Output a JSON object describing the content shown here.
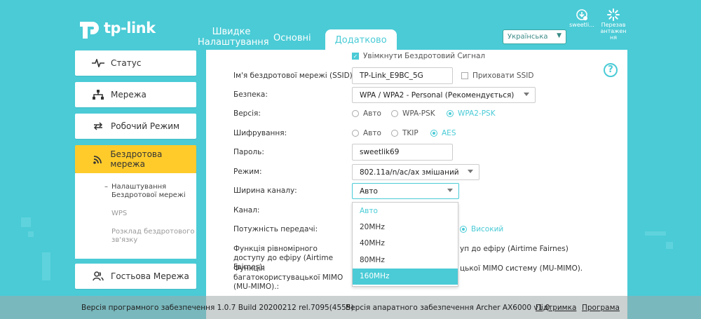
{
  "brand": {
    "logo_text": "tp-link",
    "accent": "#4acbd6",
    "highlight": "#fecb2b"
  },
  "tabs": [
    {
      "label": "Швидке Налаштування"
    },
    {
      "label": "Основні"
    },
    {
      "label": "Додатково"
    }
  ],
  "language": {
    "selected": "Українська"
  },
  "tools": [
    {
      "label": "sweetli...",
      "icon": "user-download-icon"
    },
    {
      "label": "Перезав антажен ня",
      "icon": "reboot-icon"
    }
  ],
  "sidebar": {
    "items": [
      {
        "label": "Статус",
        "icon": "pulse-icon"
      },
      {
        "label": "Мережа",
        "icon": "network-icon"
      },
      {
        "label": "Робочий Режим",
        "icon": "mode-icon"
      },
      {
        "label": "Бездротова мережа",
        "icon": "wifi-icon"
      },
      {
        "label": "Гостьова Мережа",
        "icon": "guest-icon"
      }
    ],
    "submenu": [
      {
        "label": "Налаштування Бездротової мережі"
      },
      {
        "label": "WPS"
      },
      {
        "label": "Розклад бездротового зв'язку"
      }
    ]
  },
  "form": {
    "enable_label": "Увімкнути Бездротовий Сигнал",
    "ssid_label": "Ім'я бездротової мережі (SSID):",
    "ssid_value": "TP-Link_E9BC_5G",
    "hide_ssid_label": "Приховати SSID",
    "security_label": "Безпека:",
    "security_value": "WPA / WPA2 - Personal (Рекомендується)",
    "version_label": "Версія:",
    "version_options": [
      "Авто",
      "WPA-PSK",
      "WPA2-PSK"
    ],
    "encryption_label": "Шифрування:",
    "encryption_options": [
      "Авто",
      "TKIP",
      "AES"
    ],
    "password_label": "Пароль:",
    "password_value": "sweetlik69",
    "mode_label": "Режим:",
    "mode_value": "802.11a/n/ac/ax змішаний",
    "width_label": "Ширина каналу:",
    "width_value": "Авто",
    "channel_label": "Канал:",
    "power_label": "Потужність передачі:",
    "power_visible_option": "Високий",
    "airtime_label": "Функція рівномірного доступу до ефіру (Airtime Fairnes):",
    "airtime_visible_text": "уп до ефіру (Airtime Fairnes)",
    "mumimo_label": "Функція багатокористувацької MIMO (MU-MIMO).:",
    "mumimo_visible_text": "цької MIMO систему (MU-MIMO).",
    "width_options": [
      "Авто",
      "20MHz",
      "40MHz",
      "80MHz",
      "160MHz"
    ]
  },
  "help_glyph": "?",
  "footer": {
    "firmware": "Версія програмного забезпечення 1.0.7 Build 20200212 rel.7095(4555)",
    "hardware": "Версія апаратного забезпечення Archer AX6000 v1.0",
    "support": "Підтримка",
    "app": "Програма"
  }
}
